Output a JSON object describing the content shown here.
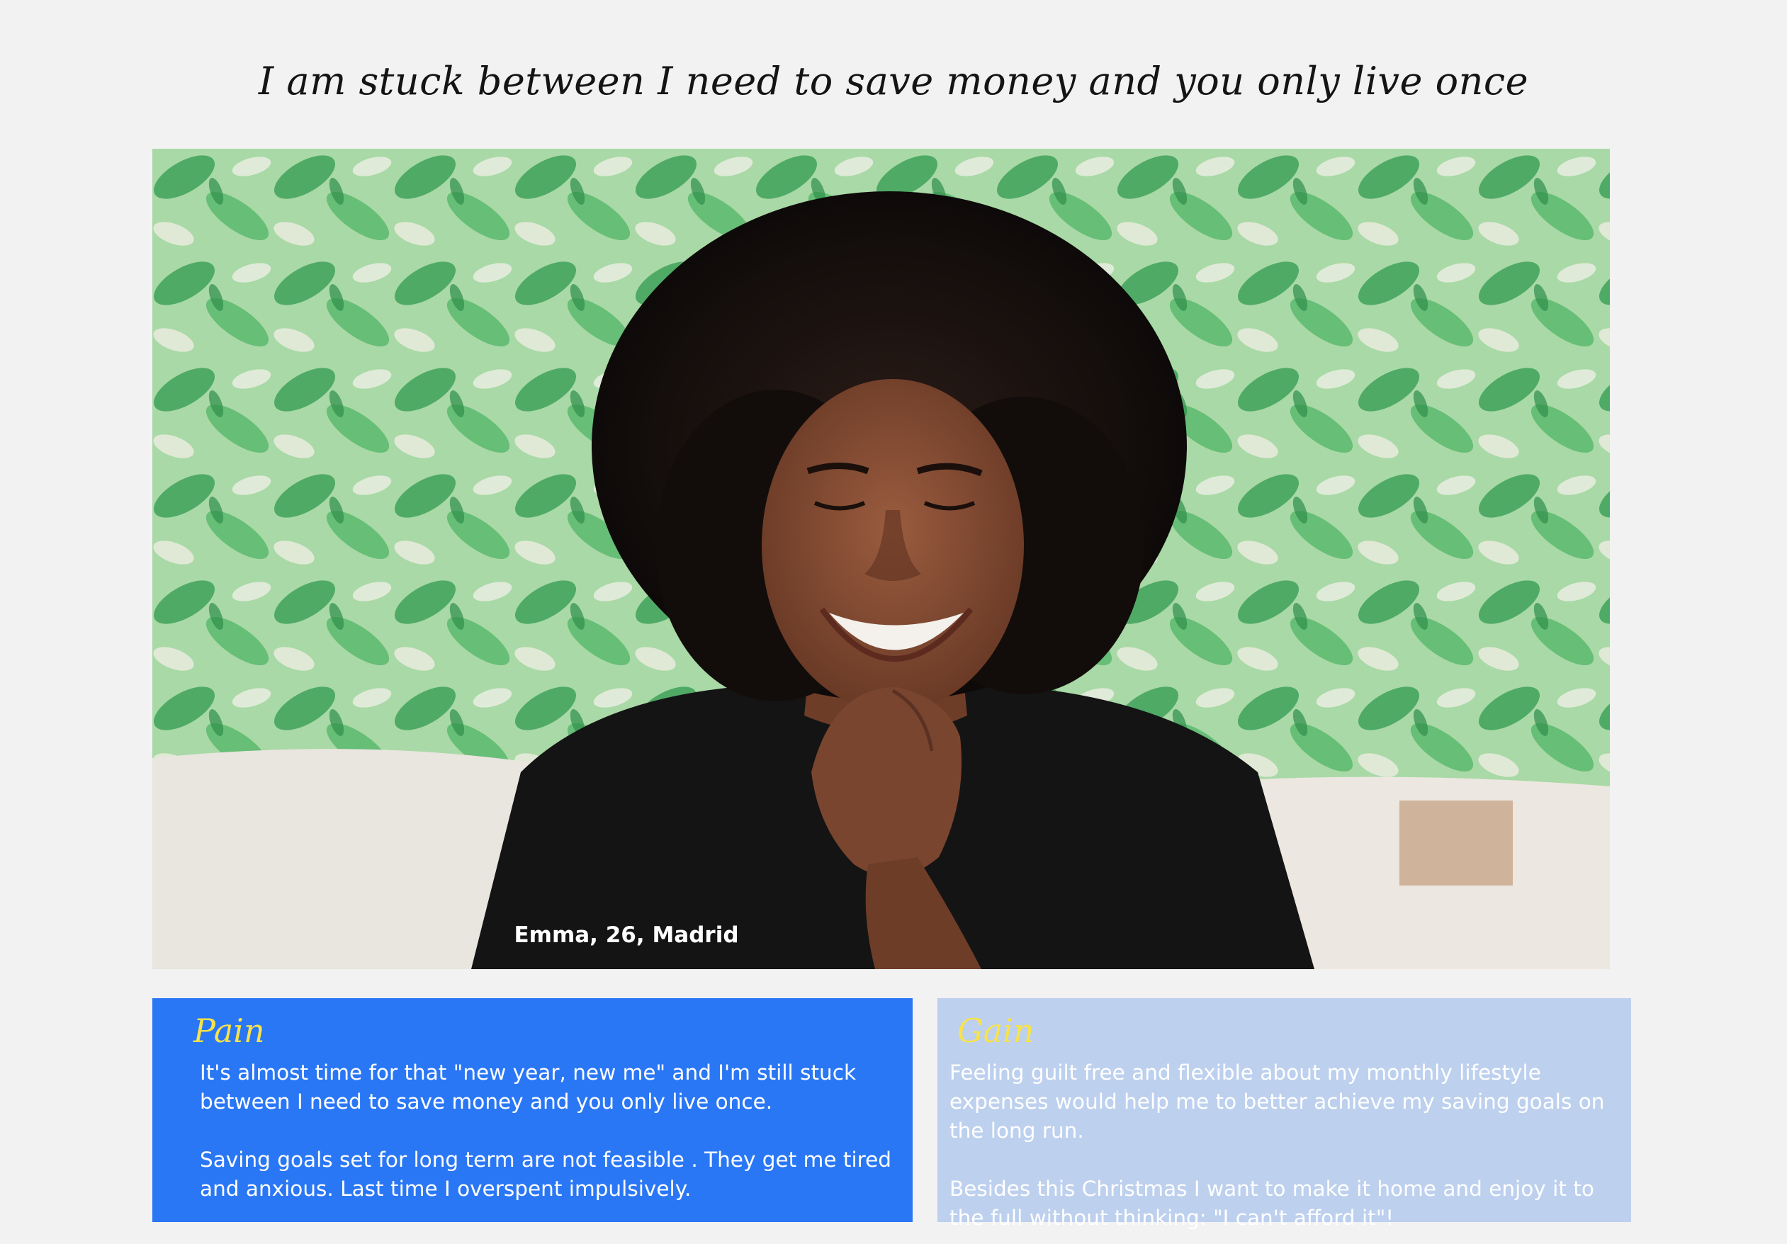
{
  "headline": "I am stuck between I need to save money and you only live once",
  "persona": {
    "caption": "Emma, 26, Madrid",
    "photo_description": "smiling-woman-photo"
  },
  "pain": {
    "title": "Pain",
    "paragraphs": [
      "It's almost time for that \"new year, new me\" and I'm still stuck between I need to save money and you only live once.",
      "Saving goals set for long term are not feasible . They get me tired and anxious. Last time I overspent impulsively."
    ]
  },
  "gain": {
    "title": "Gain",
    "paragraphs": [
      "Feeling guilt free and flexible about my monthly lifestyle expenses would help me to better achieve my saving goals on the long run.",
      "Besides this Christmas I want to make it home and enjoy it to the full without thinking: \"I can't afford it\"!"
    ]
  },
  "colors": {
    "page_background": "#f2f2f2",
    "pain_background": "#2a77f5",
    "gain_background": "#bdd0ee",
    "card_title": "#f7e24b",
    "card_text": "#ffffff"
  }
}
